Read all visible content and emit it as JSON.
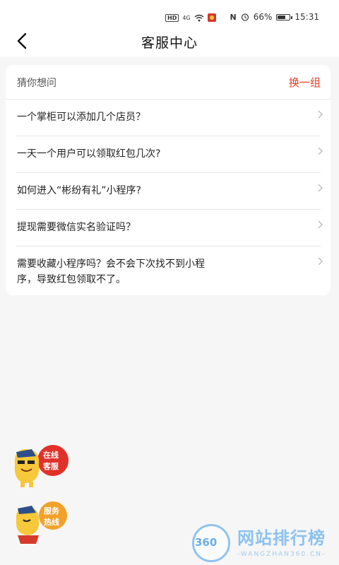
{
  "status_bar": {
    "hd": "HD",
    "network": "4G",
    "battery": "66%",
    "time": "15:31"
  },
  "nav": {
    "title": "客服中心"
  },
  "faq": {
    "header_label": "猜你想问",
    "refresh_label": "换一组",
    "items": [
      "一个掌柜可以添加几个店员？",
      "一天一个用户可以领取红包几次?",
      "如何进入“彬纷有礼”小程序?",
      "提现需要微信实名验证吗？",
      "需要收藏小程序吗？会不会下次找不到小程序，导致红包领取不了。"
    ]
  },
  "floating": {
    "chat_label_1": "在线",
    "chat_label_2": "客服",
    "hotline_label_1": "服务",
    "hotline_label_2": "热线",
    "chat_color": "#e0312a",
    "hotline_color": "#f1a12a"
  },
  "watermark": {
    "number": "360",
    "title": "网站排行榜",
    "sub": "-WANGZHAN360.CN-"
  }
}
